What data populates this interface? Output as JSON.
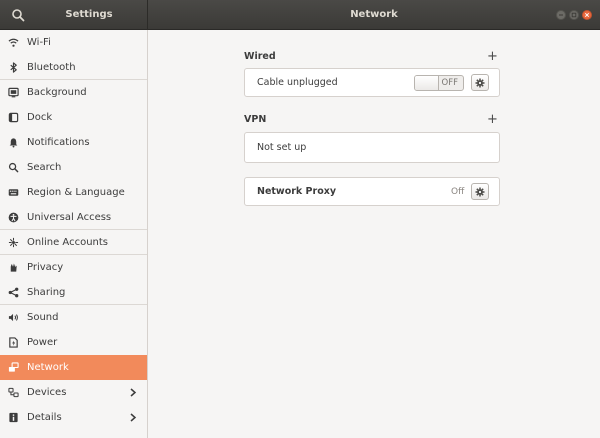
{
  "window": {
    "app_title": "Settings",
    "page_title": "Network"
  },
  "sidebar": {
    "items": [
      {
        "label": "Wi-Fi",
        "icon": "wifi-icon"
      },
      {
        "label": "Bluetooth",
        "icon": "bluetooth-icon"
      },
      {
        "label": "Background",
        "icon": "background-icon"
      },
      {
        "label": "Dock",
        "icon": "dock-icon"
      },
      {
        "label": "Notifications",
        "icon": "bell-icon"
      },
      {
        "label": "Search",
        "icon": "search-icon"
      },
      {
        "label": "Region & Language",
        "icon": "keyboard-icon"
      },
      {
        "label": "Universal Access",
        "icon": "accessibility-icon"
      },
      {
        "label": "Online Accounts",
        "icon": "online-accounts-icon"
      },
      {
        "label": "Privacy",
        "icon": "privacy-icon"
      },
      {
        "label": "Sharing",
        "icon": "share-icon"
      },
      {
        "label": "Sound",
        "icon": "speaker-icon"
      },
      {
        "label": "Power",
        "icon": "power-icon"
      },
      {
        "label": "Network",
        "icon": "network-icon",
        "active": true
      },
      {
        "label": "Devices",
        "icon": "devices-icon",
        "has_submenu": true
      },
      {
        "label": "Details",
        "icon": "details-icon",
        "has_submenu": true
      }
    ]
  },
  "wired": {
    "title": "Wired",
    "add_label": "+",
    "connection_label": "Cable unplugged",
    "toggle_state": "OFF"
  },
  "vpn": {
    "title": "VPN",
    "add_label": "+",
    "empty_label": "Not set up"
  },
  "proxy": {
    "label": "Network Proxy",
    "status": "Off"
  },
  "colors": {
    "accent": "#f28a5b",
    "headerbar": "#3b3a37",
    "close_button": "#e8683e"
  }
}
